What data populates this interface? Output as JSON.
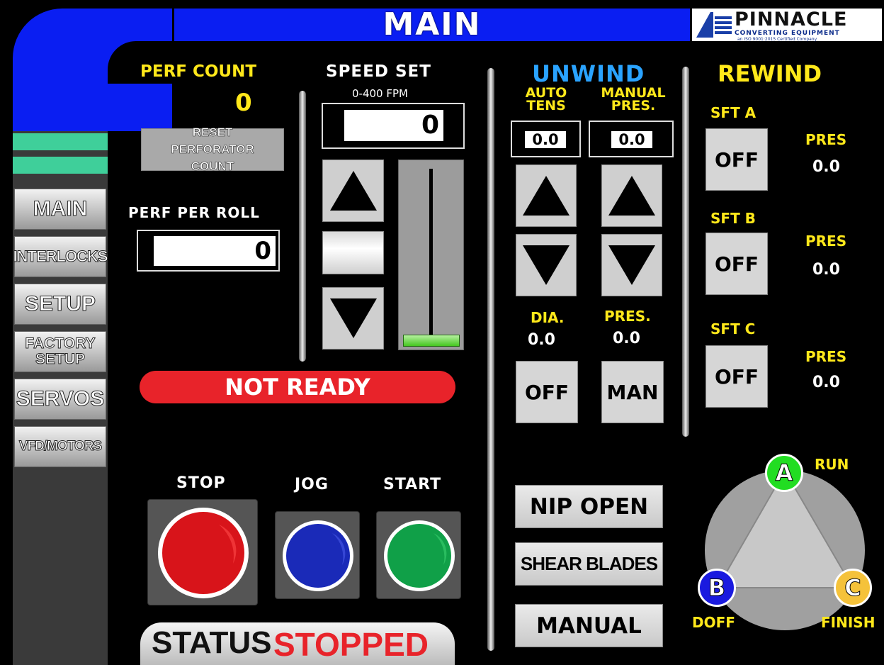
{
  "header": {
    "title": "MAIN",
    "logo": {
      "brand": "PINNACLE",
      "tagline": "CONVERTING EQUIPMENT",
      "cert": "an ISO 9001:2015 Certified Company"
    }
  },
  "nav": {
    "items": [
      {
        "label": "MAIN"
      },
      {
        "label": "INTERLOCKS"
      },
      {
        "label": "SETUP"
      },
      {
        "label": "FACTORY SETUP"
      },
      {
        "label": "SERVOS"
      },
      {
        "label": "VFD/MOTORS"
      }
    ]
  },
  "perf": {
    "count_label": "PERF COUNT",
    "count_value": "0",
    "reset_button": "RESET PERFORATOR COUNT",
    "per_roll_label": "PERF PER ROLL",
    "per_roll_value": "0"
  },
  "speed": {
    "label": "SPEED SET",
    "range": "0-400 FPM",
    "value": "0",
    "slider_level": 0
  },
  "status_banner": "NOT READY",
  "controls": {
    "stop": "STOP",
    "jog": "JOG",
    "start": "START"
  },
  "status": {
    "label": "STATUS",
    "value": "STOPPED"
  },
  "unwind": {
    "title": "UNWIND",
    "auto_tens_label": "AUTO TENS",
    "auto_tens_value": "0.0",
    "manual_pres_label": "MANUAL PRES.",
    "manual_pres_value": "0.0",
    "dia_label": "DIA.",
    "dia_value": "0.0",
    "pres_label": "PRES.",
    "pres_value": "0.0",
    "off_button": "OFF",
    "man_button": "MAN"
  },
  "actions": {
    "nip_open": "NIP OPEN",
    "shear_blades": "SHEAR BLADES",
    "manual": "MANUAL"
  },
  "rewind": {
    "title": "REWIND",
    "shafts": [
      {
        "label": "SFT A",
        "button": "OFF",
        "pres_label": "PRES",
        "pres_value": "0.0"
      },
      {
        "label": "SFT B",
        "button": "OFF",
        "pres_label": "PRES",
        "pres_value": "0.0"
      },
      {
        "label": "SFT C",
        "button": "OFF",
        "pres_label": "PRES",
        "pres_value": "0.0"
      }
    ]
  },
  "turret": {
    "a": "A",
    "b": "B",
    "c": "C",
    "run_label": "RUN",
    "doff_label": "DOFF",
    "finish_label": "FINISH",
    "colors": {
      "a": "#22dd22",
      "b": "#1a1adf",
      "c": "#f5c23a"
    }
  },
  "colors": {
    "accent_blue": "#0a1ef2",
    "accent_yellow": "#ffe81a",
    "banner_red": "#e8232a",
    "nav_green": "#3fcf9a"
  }
}
